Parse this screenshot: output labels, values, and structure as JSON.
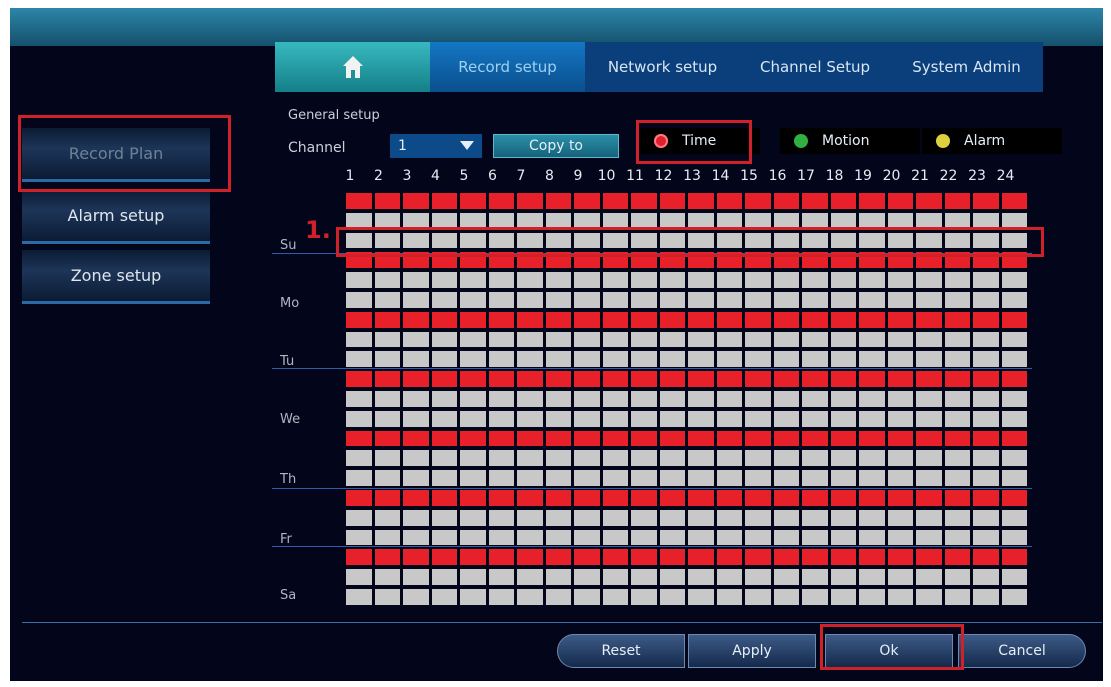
{
  "tabs": {
    "home_icon": "home-icon",
    "record_setup": "Record setup",
    "network_setup": "Network setup",
    "channel_setup": "Channel Setup",
    "system_admin": "System Admin"
  },
  "sidebar": {
    "items": [
      {
        "label": "Record Plan",
        "active": true
      },
      {
        "label": "Alarm setup",
        "active": false
      },
      {
        "label": "Zone setup",
        "active": false
      }
    ]
  },
  "section": {
    "title": "General setup"
  },
  "channel": {
    "label": "Channel",
    "value": "1"
  },
  "copy_to": {
    "label": "Copy to"
  },
  "legend": [
    {
      "label": "Time",
      "color": "#e02030"
    },
    {
      "label": "Motion",
      "color": "#30b040"
    },
    {
      "label": "Alarm",
      "color": "#e0d040"
    }
  ],
  "annotation": {
    "step": "1."
  },
  "hours": [
    "1",
    "2",
    "3",
    "4",
    "5",
    "6",
    "7",
    "8",
    "9",
    "10",
    "11",
    "12",
    "13",
    "14",
    "15",
    "16",
    "17",
    "18",
    "19",
    "20",
    "21",
    "22",
    "23",
    "24"
  ],
  "days": [
    "Su",
    "Mo",
    "Tu",
    "We",
    "Th",
    "Fr",
    "Sa"
  ],
  "schedule": {
    "mode": "Time",
    "all_hours_selected": true
  },
  "colors": {
    "record_red": "#e8202a",
    "cell_gray": "#c8c8c8",
    "accent_blue": "#2d5fa8"
  },
  "buttons": {
    "reset": "Reset",
    "apply": "Apply",
    "ok": "Ok",
    "cancel": "Cancel"
  }
}
